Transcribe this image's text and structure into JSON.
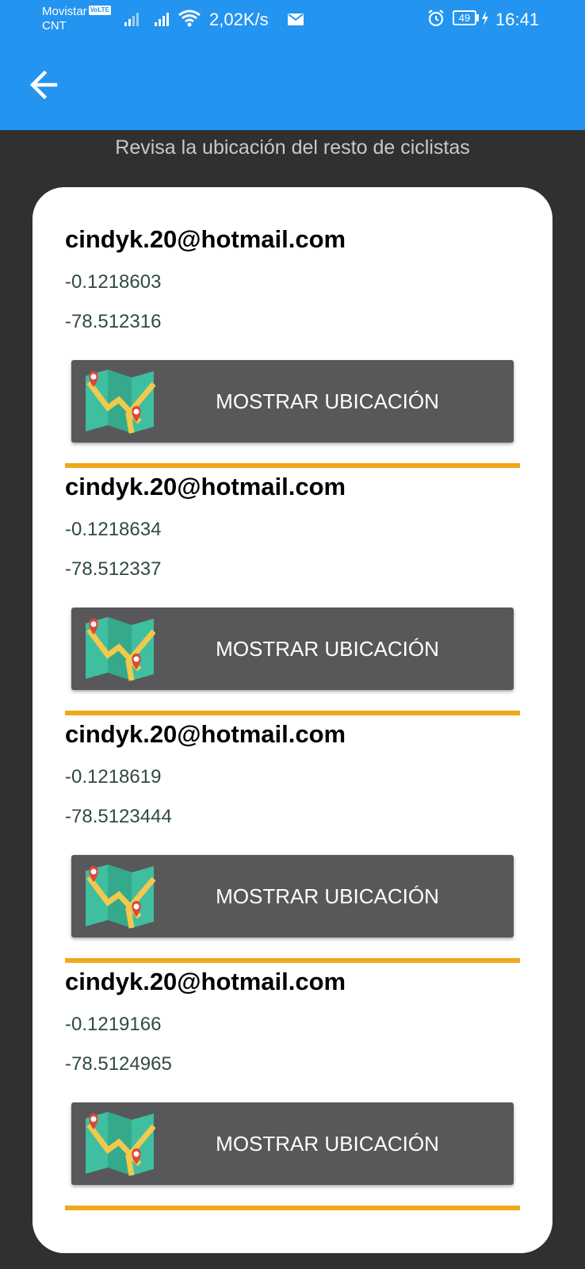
{
  "status_bar": {
    "carrier": "Movistar",
    "carrier_badge": "VoLTE",
    "carrier2": "CNT",
    "net_speed": "2,02K/s",
    "battery": "49",
    "time": "16:41"
  },
  "app_bar": {
    "back_icon": "arrow-back-icon",
    "color": "#2394EF"
  },
  "subtitle": "Revisa la ubicación del resto de ciclistas",
  "entries": [
    {
      "email": "cindyk.20@hotmail.com",
      "lat": "-0.1218603",
      "lon": "-78.512316",
      "button_label": "MOSTRAR UBICACIÓN",
      "icon": "map-icon"
    },
    {
      "email": "cindyk.20@hotmail.com",
      "lat": "-0.1218634",
      "lon": "-78.512337",
      "button_label": "MOSTRAR UBICACIÓN",
      "icon": "map-icon"
    },
    {
      "email": "cindyk.20@hotmail.com",
      "lat": "-0.1218619",
      "lon": "-78.5123444",
      "button_label": "MOSTRAR UBICACIÓN",
      "icon": "map-icon"
    },
    {
      "email": "cindyk.20@hotmail.com",
      "lat": "-0.1219166",
      "lon": "-78.5124965",
      "button_label": "MOSTRAR UBICACIÓN",
      "icon": "map-icon"
    }
  ],
  "colors": {
    "accent": "#2394EF",
    "background": "#303030",
    "button": "#58585A",
    "divider": "#F0A81A"
  }
}
